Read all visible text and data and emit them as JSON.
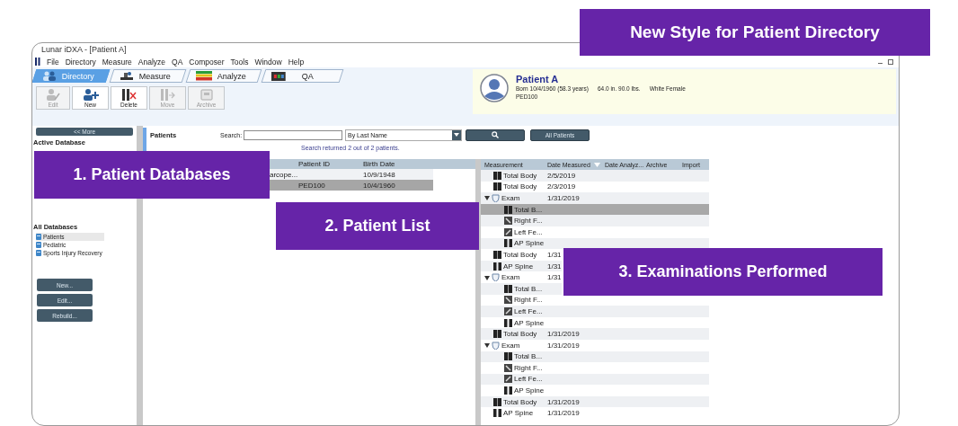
{
  "banner": {
    "title": "New Style for Patient Directory"
  },
  "callouts": [
    {
      "text": "1. Patient Databases"
    },
    {
      "text": "2. Patient List"
    },
    {
      "text": "3. Examinations Performed"
    }
  ],
  "window": {
    "title": "Lunar iDXA - [Patient A]"
  },
  "menu": [
    "File",
    "Directory",
    "Measure",
    "Analyze",
    "QA",
    "Composer",
    "Tools",
    "Window",
    "Help"
  ],
  "tabs": [
    {
      "label": "Directory",
      "kind": "directory",
      "selected": true
    },
    {
      "label": "Measure",
      "kind": "measure",
      "selected": false
    },
    {
      "label": "Analyze",
      "kind": "analyze",
      "selected": false
    },
    {
      "label": "QA",
      "kind": "qa",
      "selected": false
    }
  ],
  "toolbar": [
    {
      "label": "Edit",
      "kind": "edit",
      "disabled": true
    },
    {
      "label": "New",
      "kind": "new",
      "disabled": false
    },
    {
      "label": "Delete",
      "kind": "delete",
      "disabled": false
    },
    {
      "label": "Move",
      "kind": "move",
      "disabled": true
    },
    {
      "label": "Archive",
      "kind": "archive",
      "disabled": true
    }
  ],
  "patient": {
    "name": "Patient A",
    "born": "Born 10/4/1960  (58.3 years)",
    "size": "64.0 in.  90.0 lbs.",
    "group": "White Female",
    "id": "PED100"
  },
  "sidebar": {
    "more_button": "<< More",
    "active_heading": "Active Database",
    "all_heading": "All Databases",
    "databases": [
      {
        "label": "Patients",
        "selected": true
      },
      {
        "label": "Pediatric",
        "selected": false
      },
      {
        "label": "Sports Injury Recovery",
        "selected": false
      }
    ],
    "buttons": [
      "New...",
      "Edit...",
      "Rebuild..."
    ]
  },
  "patients": {
    "title": "Patients",
    "search_label": "Search:",
    "sort_by": "By Last Name",
    "all_button": "All Patients",
    "result": "Search returned 2 out of 2 patients.",
    "columns": [
      "Patient ID",
      "Birth Date"
    ],
    "rows": [
      {
        "column_1": "arcope...",
        "birth_date": "10/9/1948",
        "selected": false
      },
      {
        "patient_id": "PED100",
        "birth_date": "10/4/1960",
        "selected": true
      }
    ]
  },
  "measurements": {
    "columns": [
      "Measurement",
      "Date Measured",
      "Date Analyz...",
      "Archive",
      "Import"
    ],
    "rows": [
      {
        "name": "Total Body",
        "kind": "total-body",
        "date": "2/5/2019",
        "selected": false
      },
      {
        "name": "Total Body",
        "kind": "total-body",
        "date": "2/3/2019",
        "selected": false
      },
      {
        "name": "Exam",
        "kind": "exam",
        "date": "1/31/2019",
        "expanded": true,
        "selected": false,
        "children": [
          {
            "name": "Total B...",
            "kind": "total-body",
            "selected": true
          },
          {
            "name": "Right F...",
            "kind": "right-femur",
            "selected": false
          },
          {
            "name": "Left Fe...",
            "kind": "left-femur",
            "selected": false
          },
          {
            "name": "AP Spine",
            "kind": "spine",
            "selected": false
          }
        ]
      },
      {
        "name": "Total Body",
        "kind": "total-body",
        "date": "1/31",
        "selected": false
      },
      {
        "name": "AP Spine",
        "kind": "spine",
        "date": "1/31",
        "selected": false
      },
      {
        "name": "Exam",
        "kind": "exam",
        "date": "1/31",
        "expanded": true,
        "selected": false,
        "children": [
          {
            "name": "Total B...",
            "kind": "total-body",
            "selected": false
          },
          {
            "name": "Right F...",
            "kind": "right-femur",
            "selected": false
          },
          {
            "name": "Left Fe...",
            "kind": "left-femur",
            "selected": false
          },
          {
            "name": "AP Spine",
            "kind": "spine",
            "selected": false
          }
        ]
      },
      {
        "name": "Total Body",
        "kind": "total-body",
        "date": "1/31/2019",
        "selected": false
      },
      {
        "name": "Exam",
        "kind": "exam",
        "date": "1/31/2019",
        "expanded": true,
        "selected": false,
        "children": [
          {
            "name": "Total B...",
            "kind": "total-body",
            "selected": false
          },
          {
            "name": "Right F...",
            "kind": "right-femur",
            "selected": false
          },
          {
            "name": "Left Fe...",
            "kind": "left-femur",
            "selected": false
          },
          {
            "name": "AP Spine",
            "kind": "spine",
            "selected": false
          }
        ]
      },
      {
        "name": "Total Body",
        "kind": "total-body",
        "date": "1/31/2019",
        "selected": false
      },
      {
        "name": "AP Spine",
        "kind": "spine",
        "date": "1/31/2019",
        "selected": false
      }
    ]
  }
}
